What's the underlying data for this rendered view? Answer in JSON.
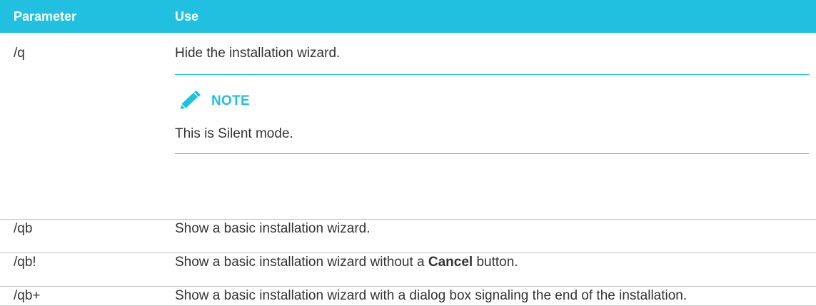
{
  "table": {
    "headers": {
      "parameter": "Parameter",
      "use": "Use"
    },
    "rows": [
      {
        "parameter": "/q",
        "use": "Hide the installation wizard.",
        "note": {
          "icon": "pencil-icon",
          "title": "NOTE",
          "text": "This is Silent mode."
        }
      },
      {
        "parameter": "/qb",
        "use": "Show a basic installation wizard."
      },
      {
        "parameter": "/qb!",
        "use_before": "Show a basic installation wizard without a ",
        "use_bold": "Cancel",
        "use_after": " button."
      },
      {
        "parameter": "/qb+",
        "use": "Show a basic installation wizard with a dialog box signaling the end of the installation."
      }
    ]
  },
  "colors": {
    "header_bg": "#21c0e0",
    "header_text": "#ffffff",
    "note_accent": "#21c0e0",
    "body_text": "#333333",
    "row_border": "#c4c4c4"
  }
}
